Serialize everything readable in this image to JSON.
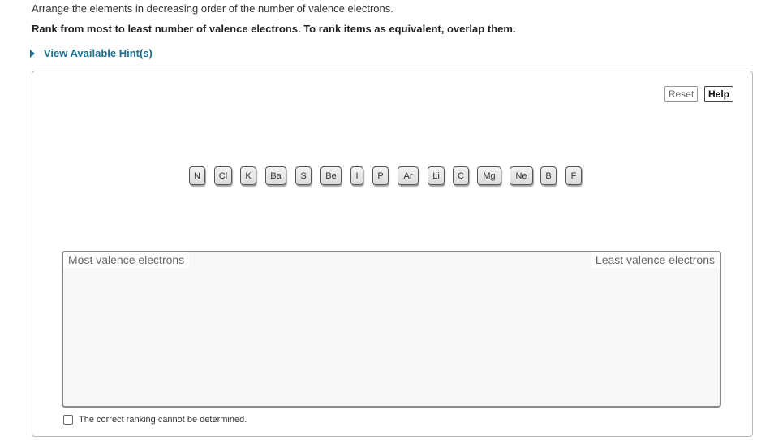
{
  "question": {
    "instruction": "Arrange the elements in decreasing order of the number of valence electrons.",
    "rank_instruction": "Rank from most to least number of valence electrons. To rank items as equivalent, overlap them.",
    "hint_label": "View Available Hint(s)"
  },
  "toolbar": {
    "reset_label": "Reset",
    "help_label": "Help"
  },
  "tiles": [
    "N",
    "Cl",
    "K",
    "Ba",
    "S",
    "Be",
    "I",
    "P",
    "Ar",
    "Li",
    "C",
    "Mg",
    "Ne",
    "B",
    "F"
  ],
  "ranking_zone": {
    "left_label": "Most valence electrons",
    "right_label": "Least valence electrons"
  },
  "cannot_determine": {
    "label": "The correct ranking cannot be determined.",
    "checked": false
  },
  "colors": {
    "link": "#1a6f93",
    "zone_background": "#f7f7f7"
  }
}
